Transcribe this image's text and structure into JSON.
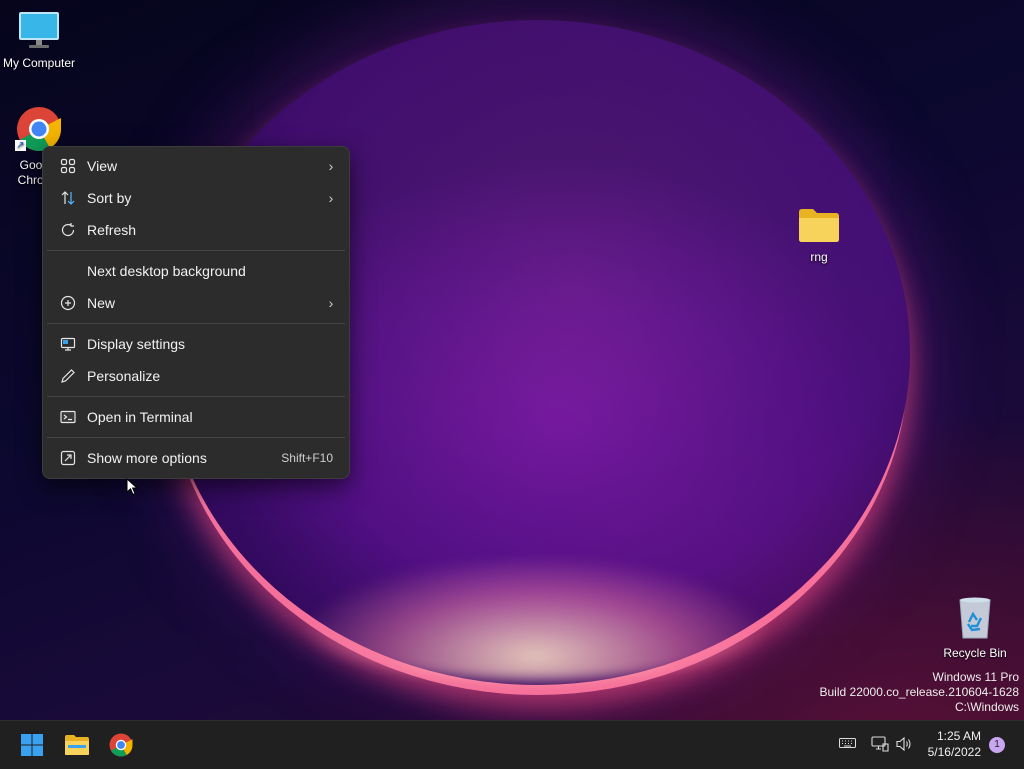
{
  "desktop": {
    "icons": [
      {
        "label": "My Computer"
      },
      {
        "label": "Google Chrome"
      },
      {
        "label": "rng"
      },
      {
        "label": "Recycle Bin"
      }
    ]
  },
  "context_menu": {
    "view": {
      "label": "View",
      "icon": "view-grid-icon",
      "submenu": true
    },
    "sort_by": {
      "label": "Sort by",
      "icon": "sort-icon",
      "submenu": true
    },
    "refresh": {
      "label": "Refresh",
      "icon": "refresh-icon"
    },
    "next_bg": {
      "label": "Next desktop background"
    },
    "new": {
      "label": "New",
      "icon": "plus-circle-icon",
      "submenu": true
    },
    "display": {
      "label": "Display settings",
      "icon": "display-icon"
    },
    "personalize": {
      "label": "Personalize",
      "icon": "pen-icon"
    },
    "terminal": {
      "label": "Open in Terminal",
      "icon": "terminal-icon"
    },
    "more": {
      "label": "Show more options",
      "icon": "more-options-icon",
      "shortcut": "Shift+F10"
    }
  },
  "watermark": {
    "line1": "Windows 11 Pro",
    "line2": "Build 22000.co_release.210604-1628",
    "line3": "C:\\Windows"
  },
  "taskbar": {
    "apps": [
      "start-icon",
      "file-explorer-icon",
      "chrome-icon"
    ],
    "tray": [
      "keyboard-icon",
      "network-icon",
      "volume-icon"
    ],
    "time": "1:25 AM",
    "date": "5/16/2022",
    "notification_count": "1"
  },
  "colors": {
    "menu_bg": "#2c2c2c",
    "taskbar_bg": "#202020",
    "win_blue": "#3aa0f0",
    "folder_yellow": "#f6c945"
  }
}
